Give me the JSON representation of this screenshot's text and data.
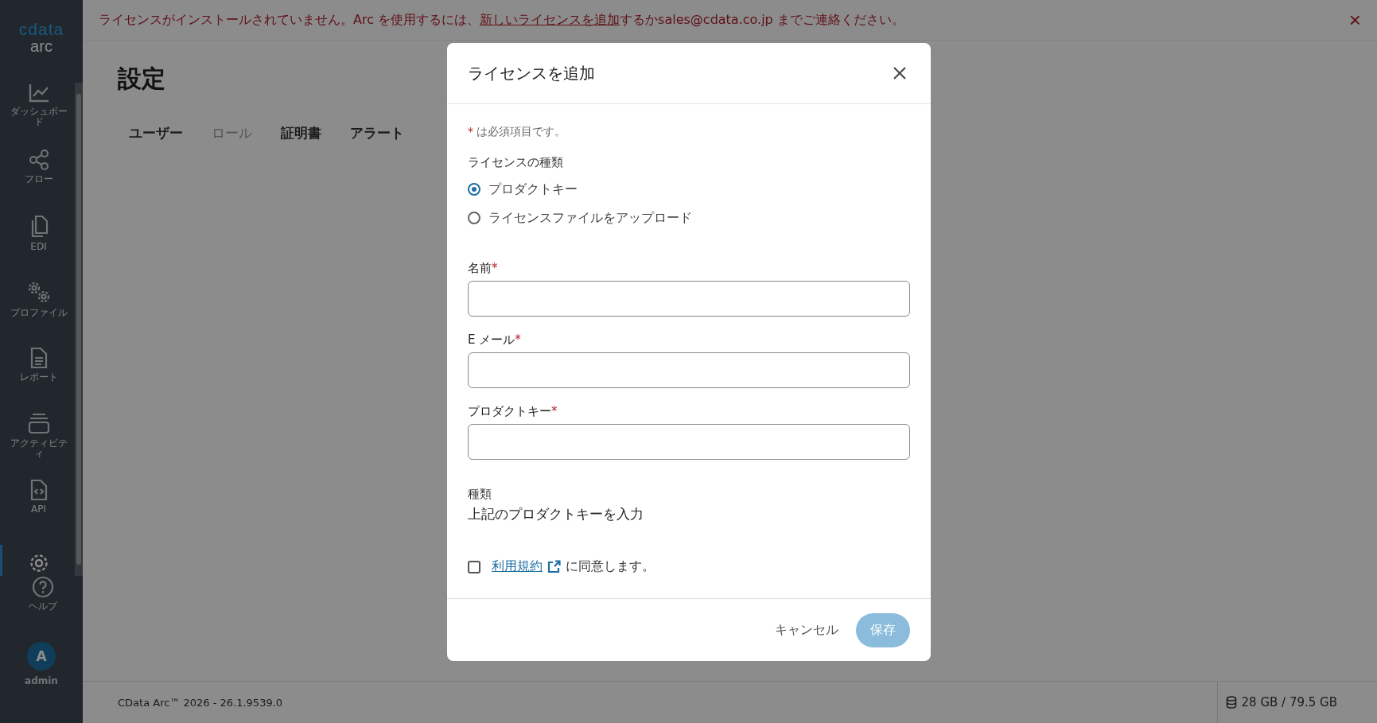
{
  "sidebar": {
    "logo": {
      "brand": "cdata",
      "product": "arc"
    },
    "items": [
      {
        "label": "ダッシュボード",
        "selected": false
      },
      {
        "label": "フロー",
        "selected": false
      },
      {
        "label": "EDI",
        "selected": false
      },
      {
        "label": "プロファイル",
        "selected": false
      },
      {
        "label": "レポート",
        "selected": false
      },
      {
        "label": "アクティビティ",
        "selected": false
      },
      {
        "label": "API",
        "selected": false
      },
      {
        "selected": true
      },
      {
        "label": "ヘルプ",
        "selected": false
      }
    ],
    "user": {
      "initial": "A",
      "name": "admin"
    }
  },
  "banner": {
    "text_before": "ライセンスがインストールされていません。Arc を使用するには、",
    "link": "新しいライセンスを追加",
    "text_middle": "するか",
    "email": "sales@cdata.co.jp",
    "text_after": " までご連絡ください。",
    "close": "×"
  },
  "page": {
    "title": "設定",
    "tabs": [
      {
        "label": "ユーザー",
        "disabled": false
      },
      {
        "label": "ロール",
        "disabled": true
      },
      {
        "label": "証明書",
        "disabled": false
      },
      {
        "label": "アラート",
        "disabled": false
      }
    ]
  },
  "status_bar": {
    "version": "CData Arc™ 2026 - 26.1.9539.0",
    "storage": "28 GB / 79.5 GB"
  },
  "dialog": {
    "title": "ライセンスを追加",
    "required_note": {
      "mark": "*",
      "text": "は必須項目です。"
    },
    "license_type": {
      "label": "ライセンスの種類",
      "options": [
        {
          "label": "プロダクトキー",
          "selected": true
        },
        {
          "label": "ライセンスファイルをアップロード",
          "selected": false
        }
      ]
    },
    "fields": [
      {
        "label": "名前",
        "required": true
      },
      {
        "label": "E メール",
        "required": true
      },
      {
        "label": "プロダクトキー",
        "required": true
      }
    ],
    "type": {
      "label": "種類",
      "value": "上記のプロダクトキーを入力"
    },
    "terms": {
      "checked": false,
      "link": "利用規約",
      "text": "に同意します。"
    },
    "buttons": {
      "cancel": "キャンセル",
      "save": "保存",
      "save_disabled": true
    }
  }
}
